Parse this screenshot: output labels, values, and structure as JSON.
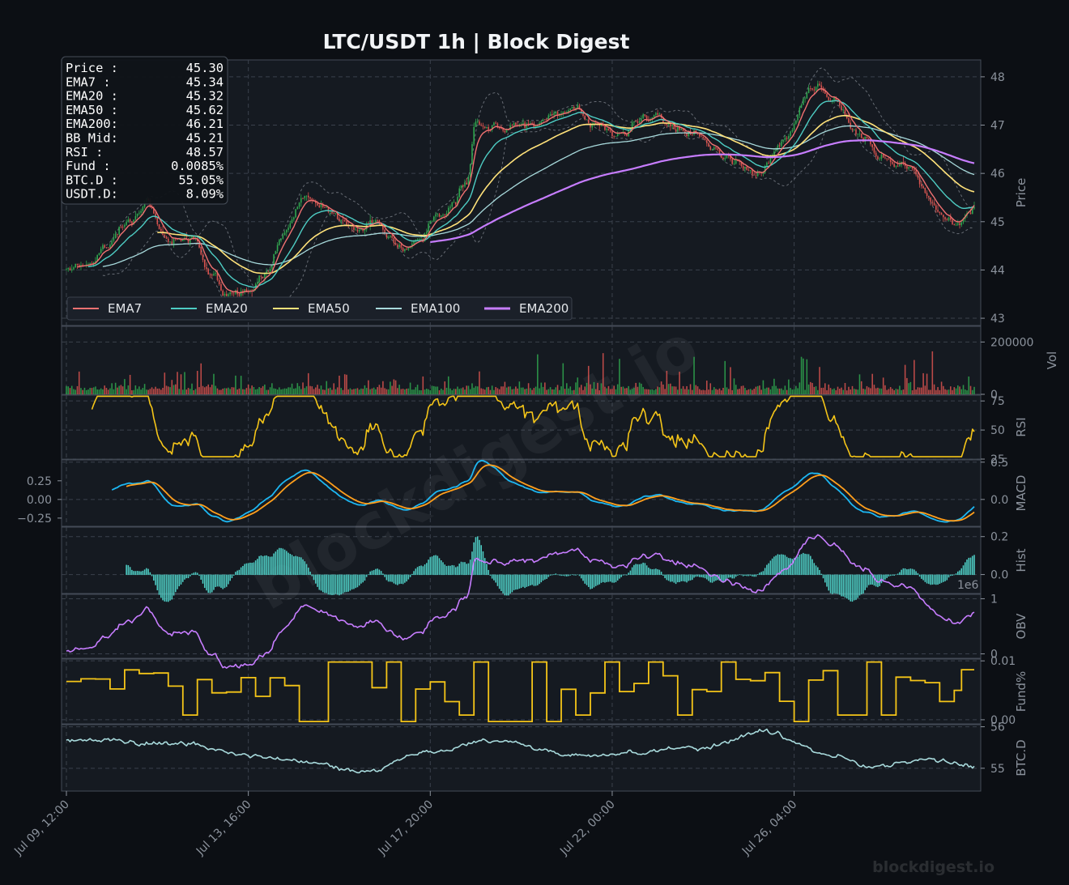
{
  "header": {
    "title": "LTC/USDT  1h  |  Block Digest"
  },
  "info_box": {
    "rows": [
      {
        "label": "Price :",
        "value": "45.30"
      },
      {
        "label": "EMA7  :",
        "value": "45.34"
      },
      {
        "label": "EMA20 :",
        "value": "45.32"
      },
      {
        "label": "EMA50 :",
        "value": "45.62"
      },
      {
        "label": "EMA200:",
        "value": "46.21"
      },
      {
        "label": "BB Mid:",
        "value": "45.21"
      },
      {
        "label": "RSI   :",
        "value": "48.57"
      },
      {
        "label": "Fund  :",
        "value": "0.0085%"
      },
      {
        "label": "BTC.D :",
        "value": "55.05%"
      },
      {
        "label": "USDT.D:",
        "value": "8.09%"
      }
    ]
  },
  "watermark": {
    "diagonal": "blockdigest.io",
    "corner": "blockdigest.io"
  },
  "colors": {
    "background": "#0c0f14",
    "panel": "#151a21",
    "grid": "#3a414c",
    "up_candle": "#2fa84f",
    "down_candle": "#d9534f",
    "ema7": "#f07171",
    "ema20": "#4ecdc4",
    "ema50": "#ffe27a",
    "ema100": "#a8dadc",
    "ema200": "#c77dff",
    "rsi": "#f5c518",
    "macd": "#1db7f2",
    "signal": "#ff9f1c",
    "hist": "#4ecdc4",
    "obv": "#c77dff",
    "fund": "#f5c518",
    "btcd": "#a8dadc"
  },
  "chart_data": {
    "type": "line",
    "x_axis": {
      "tick_labels": [
        "Jul 09, 12:00",
        "Jul 13, 16:00",
        "Jul 17, 20:00",
        "Jul 22, 00:00",
        "Jul 26, 04:00"
      ],
      "tick_index": [
        0,
        100,
        200,
        300,
        400
      ],
      "n_points": 500
    },
    "panels": [
      {
        "id": "price",
        "ylabel": "Price",
        "ylim": [
          42.85,
          48.35
        ],
        "yticks": [
          43,
          44,
          45,
          46,
          47,
          48
        ],
        "legend": {
          "placement": "lower-left",
          "entries": [
            "EMA7",
            "EMA20",
            "EMA50",
            "EMA100",
            "EMA200"
          ]
        },
        "price_anchors": [
          [
            0,
            44.0
          ],
          [
            8,
            44.1
          ],
          [
            20,
            44.5
          ],
          [
            35,
            45.0
          ],
          [
            45,
            45.3
          ],
          [
            55,
            44.75
          ],
          [
            70,
            44.6
          ],
          [
            78,
            44.0
          ],
          [
            90,
            43.55
          ],
          [
            100,
            43.55
          ],
          [
            110,
            43.9
          ],
          [
            120,
            44.8
          ],
          [
            130,
            45.6
          ],
          [
            140,
            45.3
          ],
          [
            150,
            45.0
          ],
          [
            160,
            44.9
          ],
          [
            170,
            45.05
          ],
          [
            185,
            44.5
          ],
          [
            195,
            44.8
          ],
          [
            205,
            45.1
          ],
          [
            220,
            45.8
          ],
          [
            225,
            47.1
          ],
          [
            240,
            47.0
          ],
          [
            260,
            47.1
          ],
          [
            275,
            47.3
          ],
          [
            290,
            47.0
          ],
          [
            305,
            46.8
          ],
          [
            320,
            47.2
          ],
          [
            335,
            47.0
          ],
          [
            350,
            46.9
          ],
          [
            362,
            46.3
          ],
          [
            380,
            46.0
          ],
          [
            395,
            46.8
          ],
          [
            410,
            47.8
          ],
          [
            420,
            47.5
          ],
          [
            435,
            46.8
          ],
          [
            450,
            46.3
          ],
          [
            465,
            46.2
          ],
          [
            475,
            45.5
          ],
          [
            480,
            45.2
          ],
          [
            490,
            44.9
          ],
          [
            499,
            45.3
          ]
        ],
        "ema200_start_index": 200,
        "last": {
          "price": 45.3,
          "ema7": 45.34,
          "ema20": 45.32,
          "ema50": 45.62,
          "ema200": 46.21,
          "bb_mid": 45.21
        }
      },
      {
        "id": "volume",
        "ylabel": "Vol",
        "ylim": [
          0,
          260000
        ],
        "yticks": [
          0,
          200000
        ],
        "ytick_labels": [
          "0",
          "200000"
        ],
        "typical_max": 220000
      },
      {
        "id": "rsi",
        "ylabel": "RSI",
        "ylim": [
          25,
          80
        ],
        "yticks": [
          25,
          50,
          75
        ],
        "last": 48.57
      },
      {
        "id": "macd",
        "ylabel": "MACD",
        "ylim": [
          -0.36,
          0.53
        ],
        "left_ticks": [
          0.25,
          0.0,
          -0.25
        ],
        "left_tick_labels": [
          "0.25",
          "0.00",
          "−0.25"
        ],
        "right_ticks": [
          0.0,
          0.5
        ],
        "right_tick_labels": [
          "0.0",
          "0.5"
        ]
      },
      {
        "id": "hist",
        "ylabel": "Hist",
        "ylim": [
          -0.1,
          0.25
        ],
        "yticks": [
          0.0,
          0.2
        ],
        "ytick_labels": [
          "0.0",
          "0.2"
        ]
      },
      {
        "id": "obv",
        "ylabel": "OBV",
        "ylim": [
          -0.08,
          1.08
        ],
        "yticks": [
          0,
          1
        ],
        "ytick_labels": [
          "0",
          "1"
        ],
        "scale_label": "1e6"
      },
      {
        "id": "fund",
        "ylabel": "Fund%",
        "ylim": [
          -0.0007,
          0.0103
        ],
        "yticks": [
          0.0,
          0.01
        ],
        "ytick_labels": [
          "0.00",
          "0.01"
        ],
        "last": 0.0085
      },
      {
        "id": "btcd",
        "ylabel": "BTC.D",
        "ylim": [
          54.45,
          56.05
        ],
        "yticks": [
          55,
          56
        ],
        "ytick_labels": [
          "55",
          "56"
        ],
        "last": 55.05
      }
    ]
  }
}
